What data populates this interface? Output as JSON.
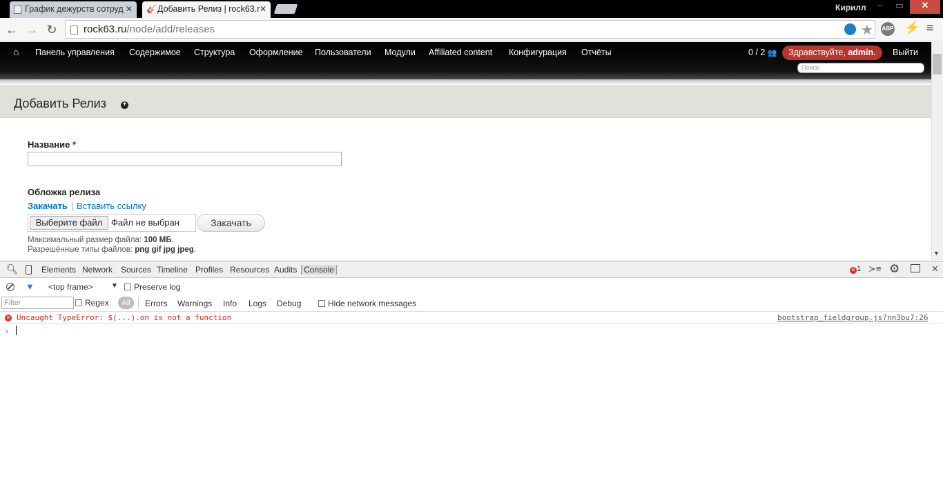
{
  "browser": {
    "tabs": [
      {
        "title": "График дежурств сотруд",
        "close": "✕"
      },
      {
        "title": "Добавить Релиз | rock63.r",
        "close": "✕"
      }
    ],
    "user": "Кирилл",
    "window_controls": {
      "minimize": "–",
      "maximize": "▭",
      "close": "✕"
    },
    "url_domain": "rock63.ru",
    "url_path": "/node/add/releases",
    "abp_label": "ABP"
  },
  "admin_toolbar": {
    "items": [
      "Панель управления",
      "Содержимое",
      "Структура",
      "Оформление",
      "Пользователи",
      "Модули",
      "Affiliated content",
      "Конфигурация",
      "Отчёты"
    ],
    "user_count": "0 / 2",
    "greeting_prefix": "Здравствуйте, ",
    "greeting_name": "admin.",
    "logout": "Выйти",
    "search_placeholder": "Поиск"
  },
  "page": {
    "title": "Добавить Релиз",
    "name_label": "Название",
    "required_mark": "*",
    "cover_label": "Обложка релиза",
    "cover_upload_tab": "Закачать",
    "cover_separator": "|",
    "cover_link_tab": "Вставить ссылку",
    "file_button": "Выберите файл",
    "file_none": "Файл не выбран",
    "upload_button": "Закачать",
    "help_max_prefix": "Максимальный размер файла: ",
    "help_max_value": "100 МБ",
    "help_types_prefix": "Разрешённые типы файлов: ",
    "help_types_value": "png gif jpg jpeg"
  },
  "devtools": {
    "tabs": [
      "Elements",
      "Network",
      "Sources",
      "Timeline",
      "Profiles",
      "Resources",
      "Audits",
      "Console"
    ],
    "active_tab": "Console",
    "error_count": "1",
    "frame": "<top frame>",
    "preserve_log": "Preserve log",
    "filter_placeholder": "Filter",
    "regex": "Regex",
    "levels": [
      "All",
      "Errors",
      "Warnings",
      "Info",
      "Logs",
      "Debug"
    ],
    "hide_network": "Hide network messages",
    "error_message": "Uncaught TypeError: $(...).on is not a function",
    "error_source": "bootstrap_fieldgroup.js?nn3bu7:26",
    "prompt": "›"
  }
}
